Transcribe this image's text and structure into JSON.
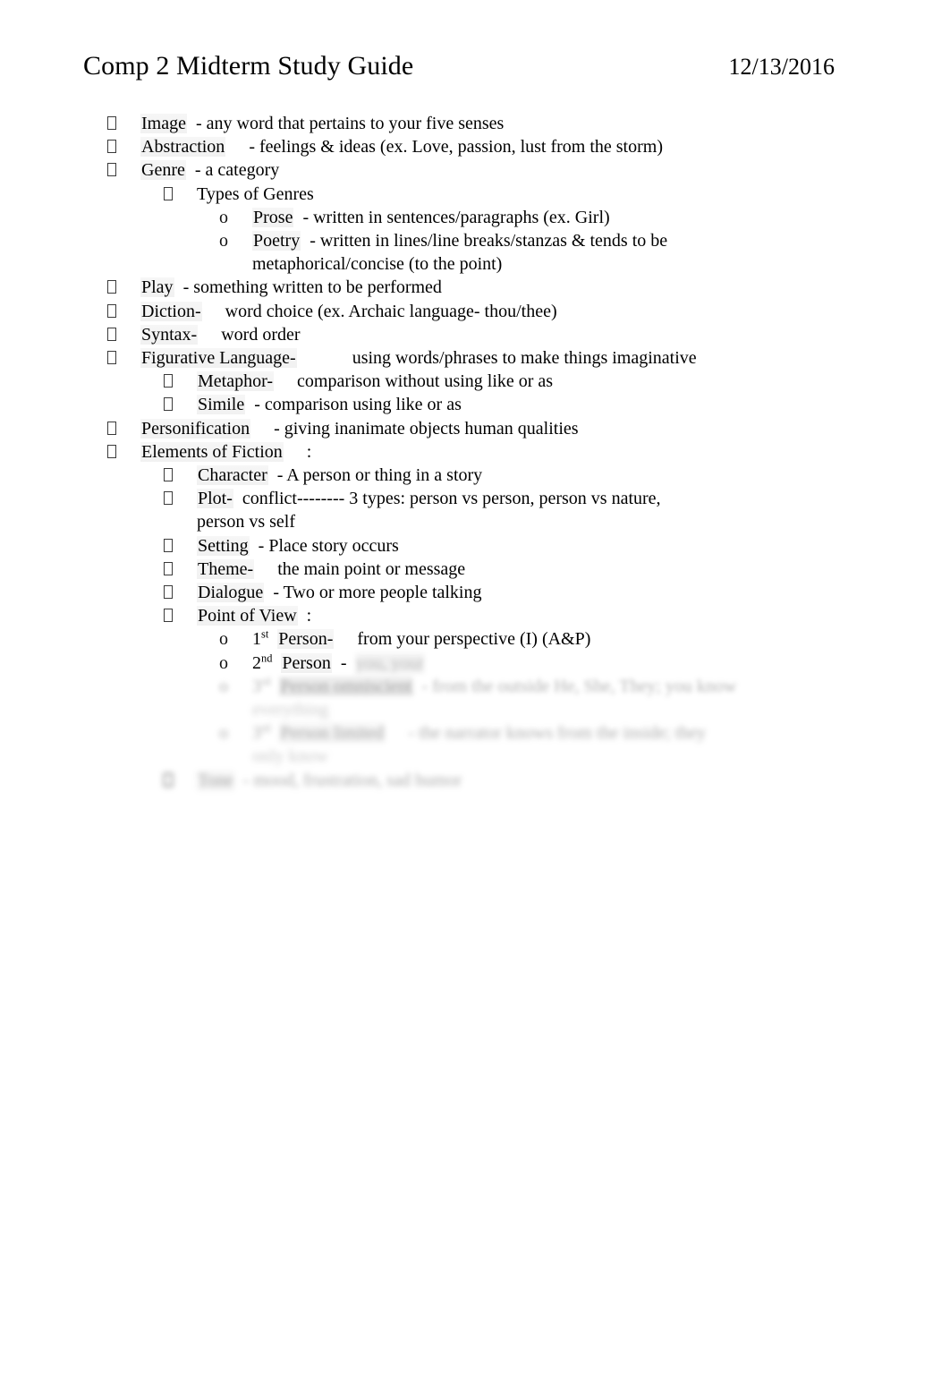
{
  "header": {
    "title": "Comp 2 Midterm Study Guide",
    "date": "12/13/2016"
  },
  "notes": {
    "image_term": "Image",
    "image_def": "- any word that pertains to your five senses",
    "abstraction_term": "Abstraction",
    "abstraction_def": "- feelings & ideas (ex. Love, passion, lust from the storm)",
    "genre_term": "Genre",
    "genre_def": "- a category",
    "types_of_genres": "Types of Genres",
    "prose_term": "Prose",
    "prose_def": "- written in sentences/paragraphs (ex. Girl)",
    "poetry_term": "Poetry",
    "poetry_def": "- written in lines/line breaks/stanzas & tends to be",
    "poetry_def_cont": "metaphorical/concise (to the point)",
    "play_term": "Play",
    "play_def": "- something written to be performed",
    "diction_term": "Diction-",
    "diction_def": "word choice (ex. Archaic language- thou/thee)",
    "syntax_term": "Syntax-",
    "syntax_def": "word order",
    "figurative_term": "Figurative Language-",
    "figurative_def": "using words/phrases to make things imaginative",
    "metaphor_term": "Metaphor-",
    "metaphor_def": "comparison without using like or as",
    "simile_term": "Simile",
    "simile_def": "- comparison using like or as",
    "personification_term": "Personification",
    "personification_def": "- giving inanimate objects human qualities",
    "elements_term": "Elements of Fiction",
    "elements_def": ":",
    "character_term": "Character",
    "character_def": "- A person or thing in a story",
    "plot_term": "Plot-",
    "plot_def": "conflict-------- 3 types: person vs person, person vs nature,",
    "plot_def_cont": "person vs self",
    "setting_term": "Setting",
    "setting_def": "- Place story occurs",
    "theme_term": "Theme-",
    "theme_def": "the main point or message",
    "dialogue_term": "Dialogue",
    "dialogue_def": "- Two or more people talking",
    "pov_term": "Point of View",
    "pov_def": ":",
    "first_person_num": "1",
    "first_person_sup": "st",
    "first_person_term": "Person-",
    "first_person_def": "from your perspective (I) (A&P)",
    "second_person_num": "2",
    "second_person_sup": "nd",
    "second_person_term": "Person",
    "second_person_dash": "-",
    "second_person_def_faded": "you, your",
    "third_omni_num": "3",
    "third_omni_sup": "rd",
    "third_omni_term": "Person omniscient",
    "third_omni_def": "- from the outside He, She, They; you know",
    "third_omni_def_cont": "everything",
    "third_limited_num": "3",
    "third_limited_sup": "rd",
    "third_limited_term": "Person limited",
    "third_limited_def": "- the narrator knows from the inside; they",
    "third_limited_def_cont": "only know",
    "tone_term": "Tone",
    "tone_def": "- mood, frustration, sad humor"
  }
}
